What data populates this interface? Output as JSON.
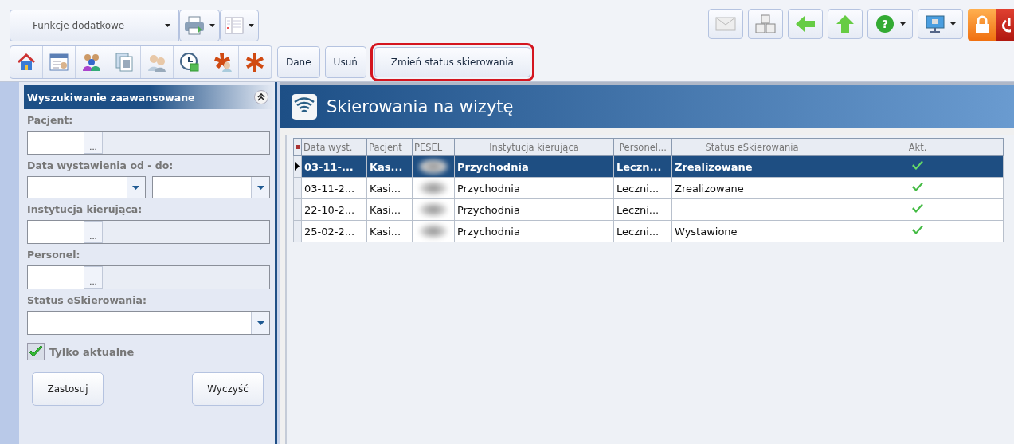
{
  "toolbar": {
    "functions_dropdown": "Funkcje dodatkowe",
    "help_glyph": "?",
    "actions": [
      {
        "label": "Dane",
        "highlighted": false
      },
      {
        "label": "Usuń",
        "highlighted": false
      },
      {
        "label": "Zmień status skierowania",
        "highlighted": true
      }
    ]
  },
  "search_panel": {
    "title": "Wyszukiwanie zaawansowane",
    "fields": [
      {
        "label": "Pacjent:",
        "kind": "picker"
      },
      {
        "label": "Data wystawienia od - do:",
        "kind": "daterange"
      },
      {
        "label": "Instytucja kierująca:",
        "kind": "picker"
      },
      {
        "label": "Personel:",
        "kind": "picker"
      },
      {
        "label": "Status eSkierowania:",
        "kind": "combo"
      }
    ],
    "picker_button": "...",
    "only_current": {
      "label": "Tylko aktualne",
      "checked": true
    },
    "buttons": [
      "Zastosuj",
      "Wyczyść"
    ]
  },
  "main": {
    "title": "Skierowania na wizytę",
    "table": {
      "columns": [
        "Data wyst.",
        "Pacjent",
        "PESEL",
        "Instytucja kierująca",
        "Personel...",
        "Status eSkierowania",
        "Akt."
      ],
      "rows": [
        {
          "selected": true,
          "cells": [
            "03-11-...",
            "Kas...",
            "",
            "Przychodnia",
            "Leczn...",
            "Zrealizowane"
          ],
          "active": true
        },
        {
          "selected": false,
          "cells": [
            "03-11-2...",
            "Kasi...",
            "",
            "Przychodnia",
            "Leczni...",
            "Zrealizowane"
          ],
          "active": true
        },
        {
          "selected": false,
          "cells": [
            "22-10-2...",
            "Kasi...",
            "",
            "Przychodnia",
            "Leczni...",
            ""
          ],
          "active": true
        },
        {
          "selected": false,
          "cells": [
            "25-02-2...",
            "Kasi...",
            "",
            "Przychodnia",
            "Leczni...",
            "Wystawione"
          ],
          "active": true
        }
      ]
    }
  }
}
